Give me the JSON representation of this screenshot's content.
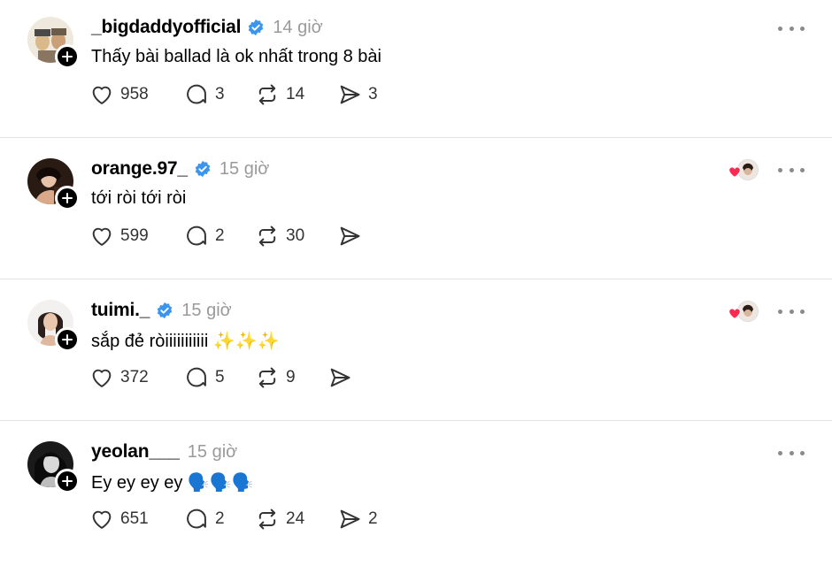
{
  "posts": [
    {
      "username": "_bigdaddyofficial",
      "verified": true,
      "time": "14 giờ",
      "content": "Thấy bài ballad là ok nhất trong 8 bài",
      "likes": "958",
      "replies": "3",
      "reposts": "14",
      "shares": "3",
      "liked_by_author": false
    },
    {
      "username": "orange.97_",
      "verified": true,
      "time": "15 giờ",
      "content": "tới ròi tới ròi",
      "likes": "599",
      "replies": "2",
      "reposts": "30",
      "shares": "",
      "liked_by_author": true
    },
    {
      "username": "tuimi._",
      "verified": true,
      "time": "15 giờ",
      "content": "sắp đẻ ròiiiiiiiiiii ✨✨✨",
      "likes": "372",
      "replies": "5",
      "reposts": "9",
      "shares": "",
      "liked_by_author": true
    },
    {
      "username": "yeolan___",
      "verified": false,
      "time": "15 giờ",
      "content": "Ey ey ey ey 🗣️🗣️🗣️",
      "likes": "651",
      "replies": "2",
      "reposts": "24",
      "shares": "2",
      "liked_by_author": false
    }
  ],
  "icons": {
    "like": "heart-icon",
    "reply": "comment-icon",
    "repost": "repost-icon",
    "share": "send-icon",
    "more": "more-icon",
    "follow": "plus-icon",
    "verified": "verified-badge-icon"
  },
  "colors": {
    "verified": "#3b95ef",
    "heart": "#ff2a4f",
    "time": "#9a9a9a",
    "icon": "#333333"
  }
}
